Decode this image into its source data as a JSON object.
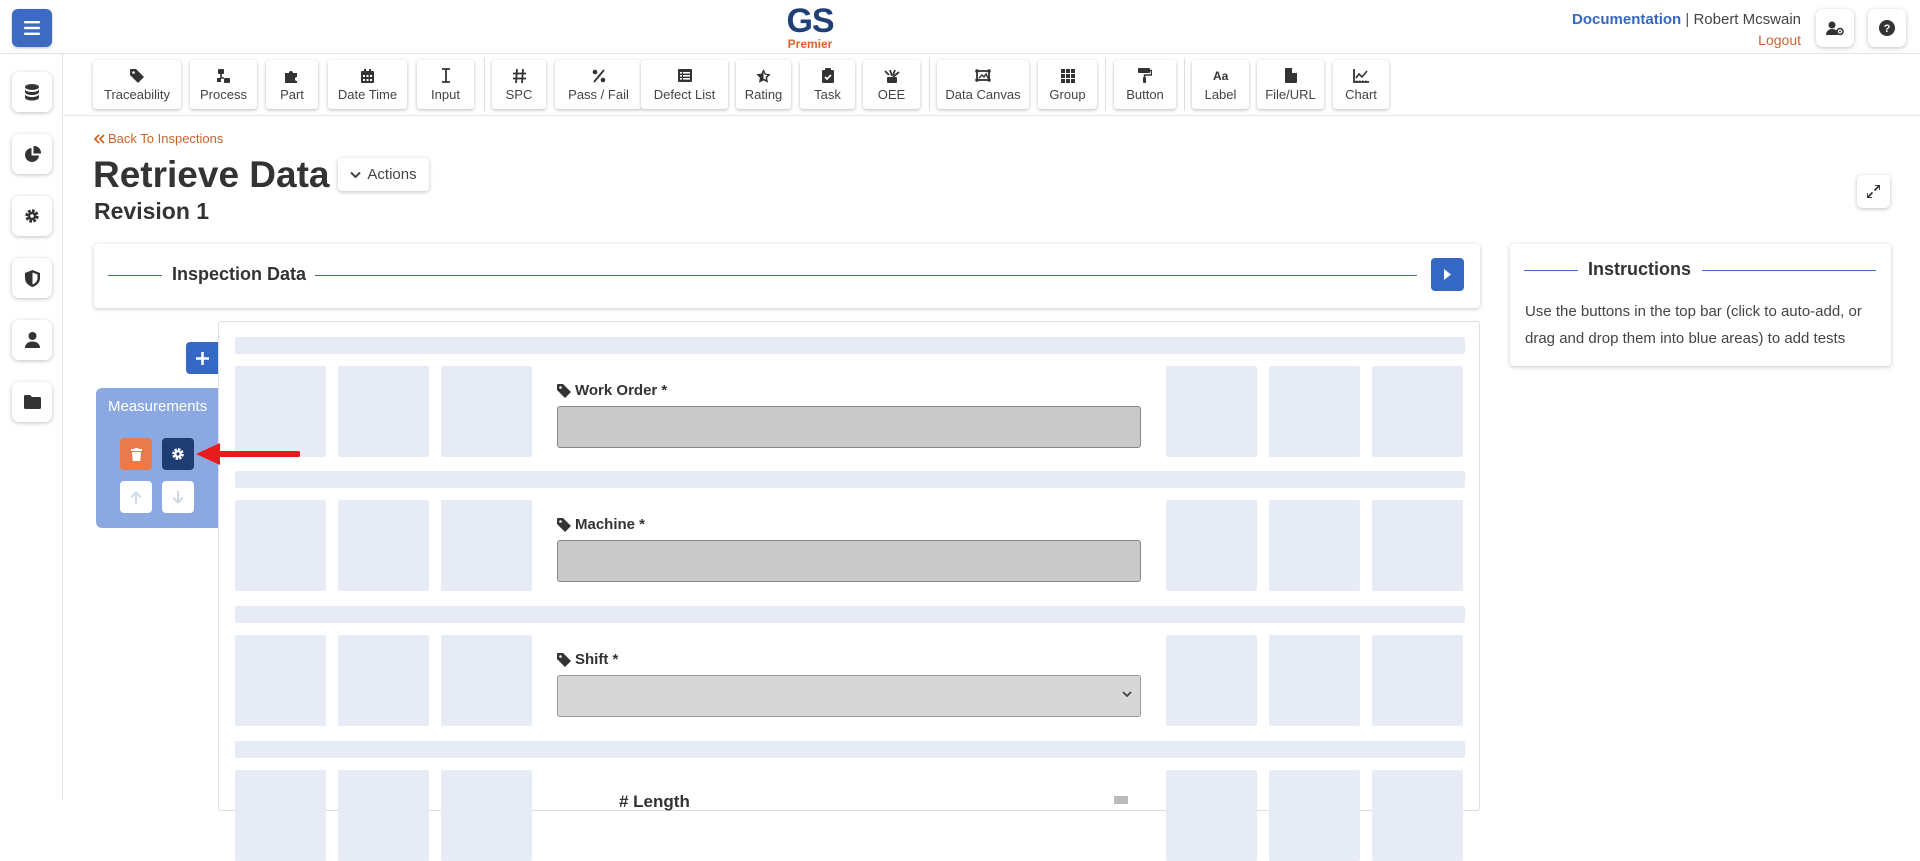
{
  "header": {
    "logo_main": "GS",
    "logo_sub": "Premier",
    "documentation": "Documentation",
    "separator": "|",
    "user_name": "Robert Mcswain",
    "logout": "Logout",
    "icons": [
      "hamburger-icon",
      "user-settings-icon",
      "help-icon"
    ]
  },
  "sidebar": {
    "items": [
      {
        "icon": "database-icon"
      },
      {
        "icon": "pie-chart-icon"
      },
      {
        "icon": "gear-icon"
      },
      {
        "icon": "shield-icon"
      },
      {
        "icon": "user-icon"
      },
      {
        "icon": "folder-icon"
      }
    ]
  },
  "toolbar": {
    "items": [
      {
        "label": "Traceability",
        "icon": "tag-icon"
      },
      {
        "label": "Process",
        "icon": "process-icon"
      },
      {
        "label": "Part",
        "icon": "puzzle-icon"
      },
      {
        "label": "Date Time",
        "icon": "calendar-icon"
      },
      {
        "label": "Input",
        "icon": "text-cursor-icon"
      },
      {
        "label": "SPC",
        "icon": "hash-icon"
      },
      {
        "label": "Pass / Fail",
        "icon": "percent-icon"
      },
      {
        "label": "Defect List",
        "icon": "list-icon"
      },
      {
        "label": "Rating",
        "icon": "star-icon"
      },
      {
        "label": "Task",
        "icon": "clipboard-check-icon"
      },
      {
        "label": "OEE",
        "icon": "oee-icon"
      },
      {
        "label": "Data Canvas",
        "icon": "canvas-icon"
      },
      {
        "label": "Group",
        "icon": "grid-icon"
      },
      {
        "label": "Button",
        "icon": "paint-roller-icon"
      },
      {
        "label": "Label",
        "icon": "font-icon"
      },
      {
        "label": "File/URL",
        "icon": "file-icon"
      },
      {
        "label": "Chart",
        "icon": "chart-line-icon"
      }
    ]
  },
  "main": {
    "back_link": "Back To Inspections",
    "title": "Retrieve Data",
    "actions_label": "Actions",
    "revision": "Revision 1",
    "inspection_data_title": "Inspection Data",
    "instructions": {
      "title": "Instructions",
      "text": "Use the buttons in the top bar (click to auto-add, or drag and drop them into blue areas) to add tests"
    },
    "group": {
      "title": "Measurements"
    },
    "fields": [
      {
        "label": "Work Order *",
        "type": "input",
        "value": ""
      },
      {
        "label": "Machine *",
        "type": "input",
        "value": ""
      },
      {
        "label": "Shift *",
        "type": "select",
        "value": ""
      }
    ],
    "partial_field_label": "# Length"
  },
  "colors": {
    "primary_blue": "#3568c4",
    "navy": "#1f3d73",
    "orange": "#e0632b",
    "drop_zone": "#e6ebf6",
    "group_blue": "#8ba9e0",
    "annotation_red": "#e81c1c"
  }
}
